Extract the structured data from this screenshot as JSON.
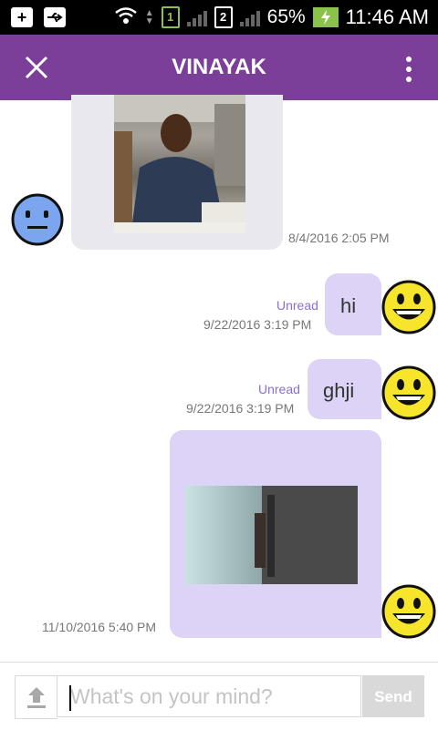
{
  "status_bar": {
    "sim1": "1",
    "sim2": "2",
    "battery_percent": "65%",
    "time": "11:46 AM"
  },
  "header": {
    "title": "VINAYAK",
    "close_icon": "close-icon",
    "menu_icon": "more-vert-icon",
    "color": "#7b3f99"
  },
  "messages": [
    {
      "direction": "incoming",
      "type": "image",
      "timestamp": "8/4/2016 2:05 PM"
    },
    {
      "direction": "outgoing",
      "type": "text",
      "text": "hi",
      "status": "Unread",
      "timestamp": "9/22/2016 3:19 PM"
    },
    {
      "direction": "outgoing",
      "type": "text",
      "text": "ghji",
      "status": "Unread",
      "timestamp": "9/22/2016 3:19 PM"
    },
    {
      "direction": "outgoing",
      "type": "image",
      "timestamp": "11/10/2016 5:40 PM"
    }
  ],
  "composer": {
    "placeholder": "What's on your mind?",
    "send_label": "Send",
    "upload_icon": "upload-icon"
  },
  "colors": {
    "incoming_bubble": "#e8e8ee",
    "outgoing_bubble": "#dcd3f6",
    "unread_text": "#8a6fd1"
  }
}
